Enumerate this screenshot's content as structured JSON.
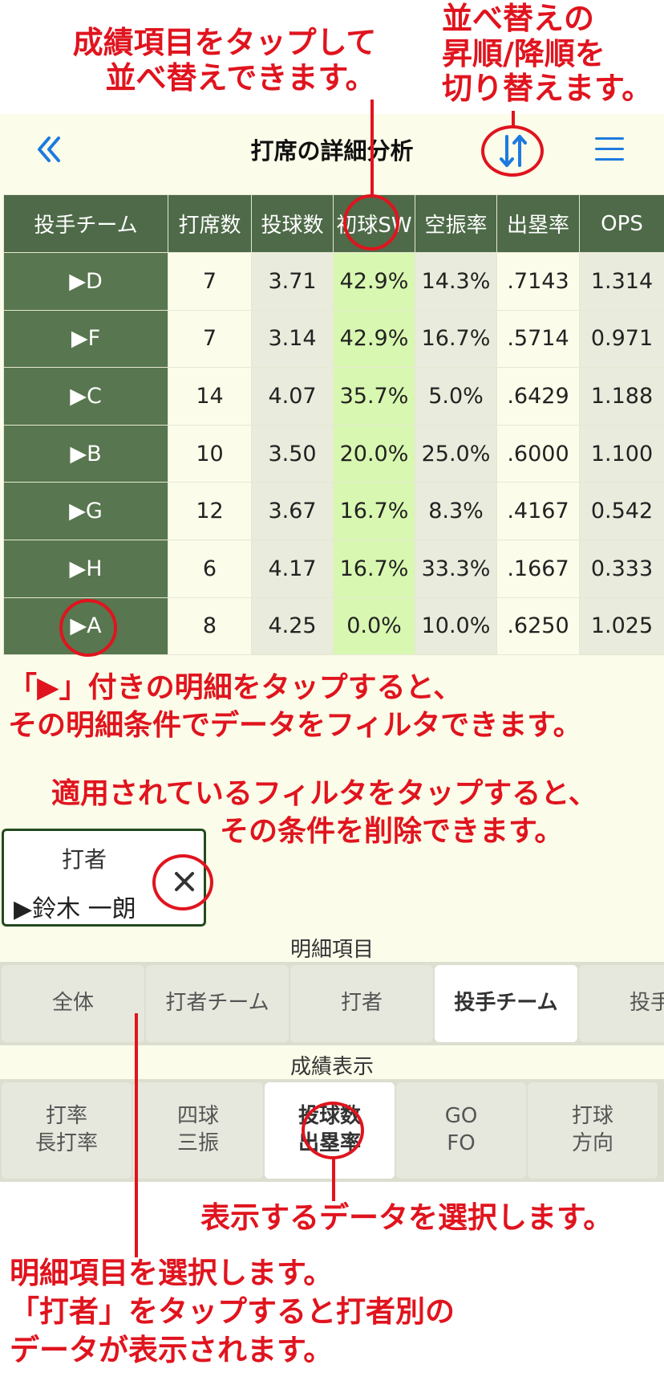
{
  "annotations": {
    "sort_header": [
      "成績項目をタップして",
      "並べ替えできます。"
    ],
    "sort_order": [
      "並べ替えの",
      "昇順/降順を",
      "切り替えます。"
    ],
    "row_tap": [
      "「▶」付きの明細をタップすると、",
      "その明細条件でデータをフィルタできます。"
    ],
    "filter_remove": [
      "適用されているフィルタをタップすると、",
      "その条件を削除できます。"
    ],
    "display_select": [
      "表示するデータを選択します。"
    ],
    "detail_select": [
      "明細項目を選択します。",
      "「打者」をタップすると打者別の",
      "データが表示されます。"
    ]
  },
  "nav": {
    "title": "打席の詳細分析",
    "back_icon": "double-chevron-left-icon",
    "sort_icon": "sort-toggle-icon",
    "menu_icon": "hamburger-menu-icon"
  },
  "table": {
    "headers": [
      "投手チーム",
      "打席数",
      "投球数",
      "初球SW",
      "空振率",
      "出塁率",
      "OPS"
    ],
    "rows": [
      [
        "▶D",
        "7",
        "3.71",
        "42.9%",
        "14.3%",
        ".7143",
        "1.314"
      ],
      [
        "▶F",
        "7",
        "3.14",
        "42.9%",
        "16.7%",
        ".5714",
        "0.971"
      ],
      [
        "▶C",
        "14",
        "4.07",
        "35.7%",
        "5.0%",
        ".6429",
        "1.188"
      ],
      [
        "▶B",
        "10",
        "3.50",
        "20.0%",
        "25.0%",
        ".6000",
        "1.100"
      ],
      [
        "▶G",
        "12",
        "3.67",
        "16.7%",
        "8.3%",
        ".4167",
        "0.542"
      ],
      [
        "▶H",
        "6",
        "4.17",
        "16.7%",
        "33.3%",
        ".1667",
        "0.333"
      ],
      [
        "▶A",
        "8",
        "4.25",
        "0.0%",
        "10.0%",
        ".6250",
        "1.025"
      ]
    ]
  },
  "filter": {
    "label": "打者",
    "value": "▶鈴木 一朗",
    "close_icon": "close-icon"
  },
  "detail_section": {
    "label": "明細項目",
    "items": [
      "全体",
      "打者チーム",
      "打者",
      "投手チーム",
      "投手"
    ],
    "active": "投手チーム"
  },
  "display_section": {
    "label": "成績表示",
    "items": [
      [
        "打率",
        "長打率"
      ],
      [
        "四球",
        "三振"
      ],
      [
        "投球数",
        "出塁率"
      ],
      [
        "GO",
        "FO"
      ],
      [
        "打球",
        "方向"
      ]
    ],
    "active": "投球数"
  },
  "colors": {
    "annotation": "#e0141e",
    "accent": "#1d7ae0",
    "header_green": "#4e6a48",
    "highlight_column": "#d8f7b0"
  }
}
